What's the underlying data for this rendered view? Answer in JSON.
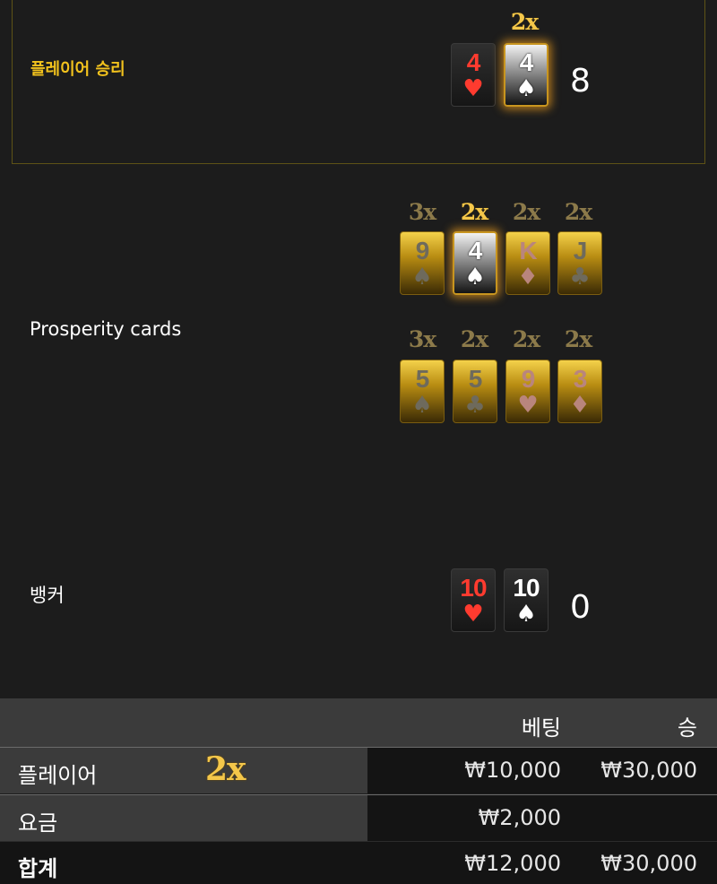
{
  "player": {
    "label": "플레이어 승리",
    "score": "8",
    "multiplier": "2x",
    "cards": [
      {
        "rank": "4",
        "suit": "♥",
        "color": "red"
      },
      {
        "rank": "4",
        "suit": "♠",
        "color": "black"
      }
    ]
  },
  "prosperity": {
    "label": "Prosperity cards",
    "row1": [
      {
        "mult": "3x",
        "rank": "9",
        "suit": "♠"
      },
      {
        "mult": "2x",
        "rank": "4",
        "suit": "♠"
      },
      {
        "mult": "2x",
        "rank": "K",
        "suit": "♦"
      },
      {
        "mult": "2x",
        "rank": "J",
        "suit": "♣"
      }
    ],
    "row2": [
      {
        "mult": "3x",
        "rank": "5",
        "suit": "♠"
      },
      {
        "mult": "2x",
        "rank": "5",
        "suit": "♣"
      },
      {
        "mult": "2x",
        "rank": "9",
        "suit": "♥"
      },
      {
        "mult": "2x",
        "rank": "3",
        "suit": "♦"
      }
    ]
  },
  "banker": {
    "label": "뱅커",
    "score": "0",
    "cards": [
      {
        "rank": "10",
        "suit": "♥",
        "color": "red"
      },
      {
        "rank": "10",
        "suit": "♠",
        "color": "black"
      }
    ]
  },
  "table": {
    "header_bet": "베팅",
    "header_win": "승",
    "rows": [
      {
        "label": "플레이어",
        "badge": "2x",
        "bet": "₩10,000",
        "win": "₩30,000"
      },
      {
        "label": "요금",
        "bet": "₩2,000",
        "win": ""
      },
      {
        "label": "합계",
        "bet": "₩12,000",
        "win": "₩30,000"
      }
    ]
  },
  "colors": {
    "background": "#1c1c1c",
    "win_label": "#f2c21d",
    "red_suit": "#ff3b2f",
    "gold": "#f4c74a",
    "table_header": "#3b3b3b"
  }
}
